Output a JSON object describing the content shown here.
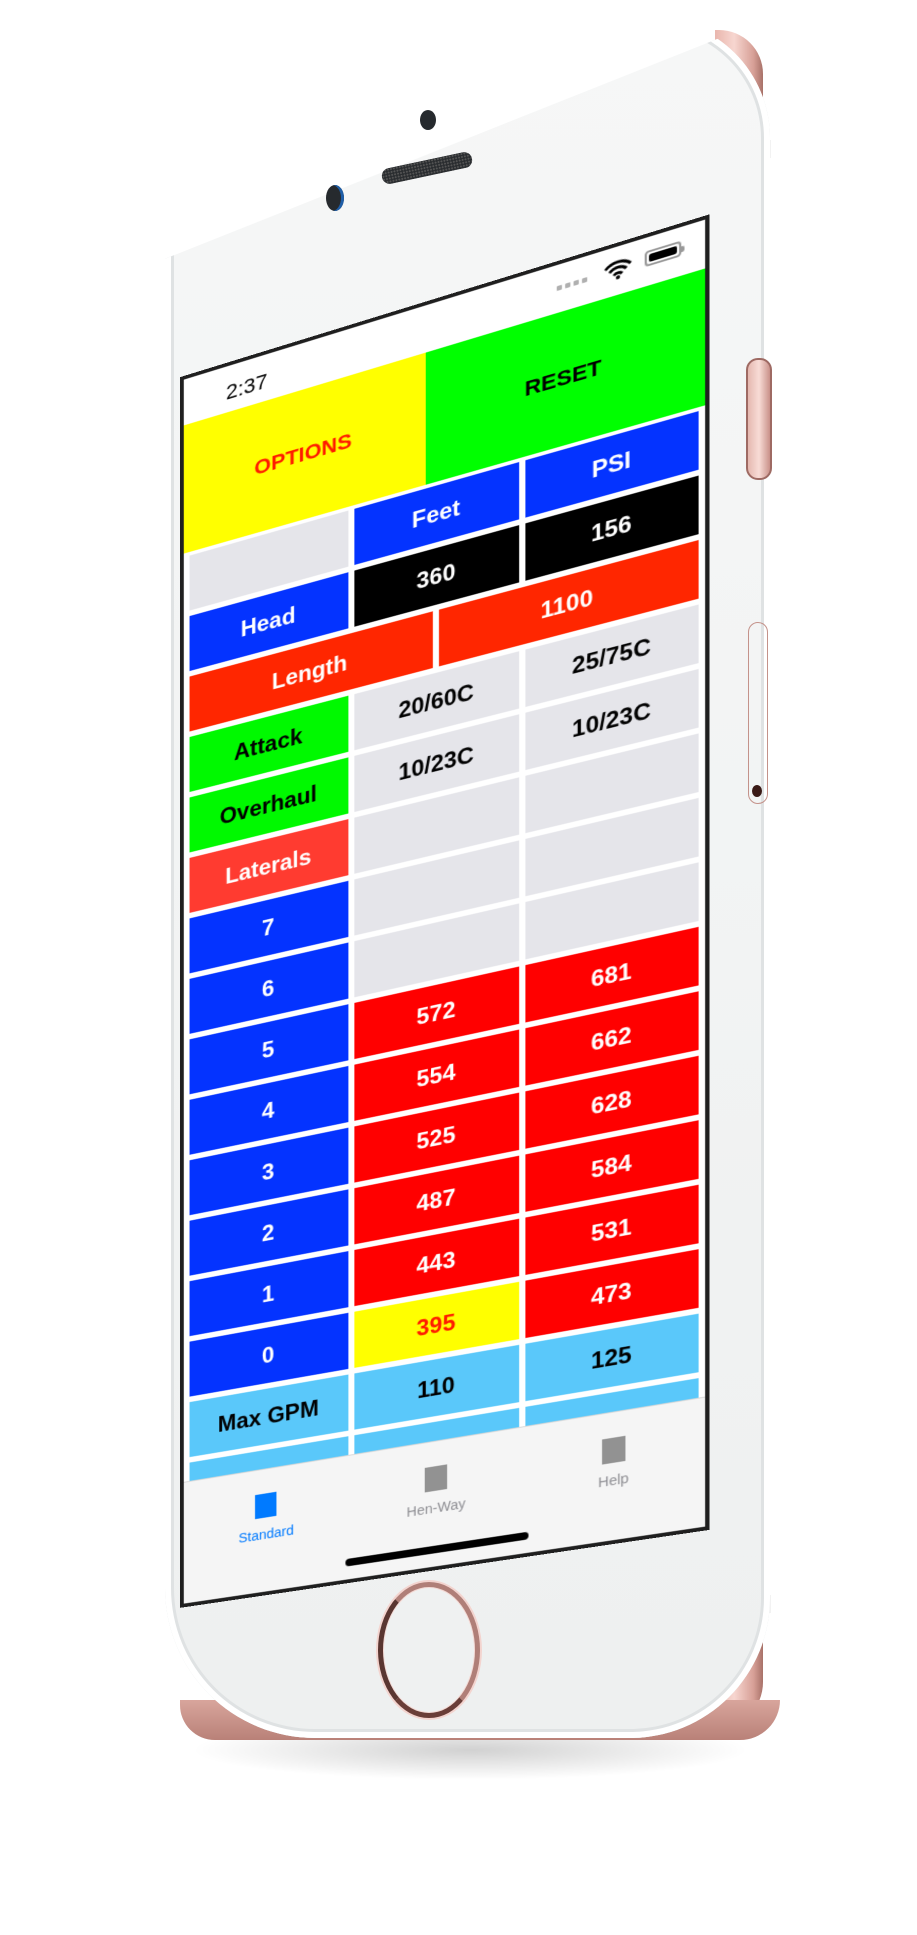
{
  "status_bar": {
    "time": "2:37",
    "signal_icon": "cellular-signal-icon",
    "wifi_icon": "wifi-icon",
    "battery_icon": "battery-icon"
  },
  "top_buttons": {
    "options_label": "OPTIONS",
    "reset_label": "RESET"
  },
  "table": {
    "header": {
      "label": "",
      "col1": "Feet",
      "col2": "PSI"
    },
    "head": {
      "label": "Head",
      "feet": "360",
      "psi": "156"
    },
    "length": {
      "label": "Length",
      "value": "1100"
    },
    "attack": {
      "label": "Attack",
      "col1": "20/60C",
      "col2": "25/75C"
    },
    "overhaul": {
      "label": "Overhaul",
      "col1": "10/23C",
      "col2": "10/23C"
    },
    "laterals": {
      "label": "Laterals",
      "col1": "",
      "col2": ""
    },
    "floors": [
      {
        "label": "7",
        "col1": "",
        "col2": ""
      },
      {
        "label": "6",
        "col1": "",
        "col2": ""
      },
      {
        "label": "5",
        "col1": "572",
        "col2": "681"
      },
      {
        "label": "4",
        "col1": "554",
        "col2": "662"
      },
      {
        "label": "3",
        "col1": "525",
        "col2": "628"
      },
      {
        "label": "2",
        "col1": "487",
        "col2": "584"
      },
      {
        "label": "1",
        "col1": "443",
        "col2": "531"
      },
      {
        "label": "0",
        "col1": "395",
        "col2": "473",
        "col1_highlight": true
      }
    ],
    "max_gpm": {
      "label": "Max GPM",
      "col1": "110",
      "col2": "125"
    }
  },
  "tab_bar": {
    "tabs": [
      {
        "label": "Standard",
        "active": true
      },
      {
        "label": "Hen-Way",
        "active": false
      },
      {
        "label": "Help",
        "active": false
      }
    ]
  },
  "colors": {
    "options_bg": "#ffff00",
    "options_text": "#ff1a00",
    "reset_bg": "#00ff00",
    "header_blue": "#0433ff",
    "value_black": "#000000",
    "pressure_red": "#ff0000",
    "length_red": "#ff2600",
    "green": "#00f900",
    "laterals_salmon": "#ff3b30",
    "empty_gray": "#e5e5ea",
    "max_gpm_sky": "#5ac8fa",
    "tab_active": "#007aff",
    "tab_inactive": "#8e8e93",
    "phone_rose_gold": "#e9b6ad"
  }
}
